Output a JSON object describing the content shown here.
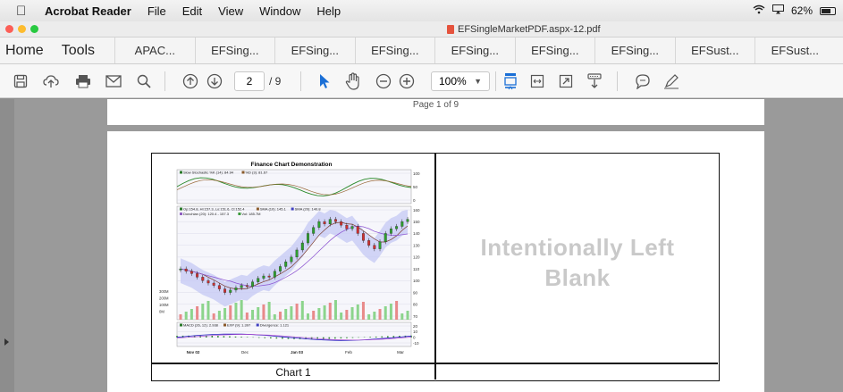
{
  "menubar": {
    "app_name": "Acrobat Reader",
    "items": [
      "File",
      "Edit",
      "View",
      "Window",
      "Help"
    ],
    "battery": "62%"
  },
  "window": {
    "document_title": "EFSingleMarketPDF.aspx-12.pdf"
  },
  "tabs": {
    "home": "Home",
    "tools": "Tools",
    "documents": [
      "APAC...",
      "EFSing...",
      "EFSing...",
      "EFSing...",
      "EFSing...",
      "EFSing...",
      "EFSing...",
      "EFSust...",
      "EFSust..."
    ]
  },
  "toolbar": {
    "current_page": "2",
    "page_count": "/ 9",
    "zoom": "100%",
    "icons": [
      "save-icon",
      "upload-icon",
      "print-icon",
      "email-icon",
      "search-icon",
      "page-up-icon",
      "page-down-icon",
      "select-arrow-icon",
      "hand-icon",
      "zoom-out-icon",
      "zoom-in-icon",
      "fit-page-icon",
      "fit-width-icon",
      "full-screen-icon",
      "read-mode-icon",
      "comment-icon",
      "sign-icon"
    ]
  },
  "page": {
    "page_label": "Page 1 of 9",
    "chart_caption": "Chart 1",
    "blank_line1": "Intentionally Left",
    "blank_line2": "Blank"
  },
  "chart_data": {
    "type": "line",
    "title": "Finance Chart Demonstration",
    "panels": [
      {
        "name": "stochastic",
        "legend": [
          "Slow Stochastic %K (14): 84.94",
          "%D (3): 81.67"
        ],
        "ylim": [
          0,
          100
        ],
        "ticks": [
          "100",
          "50",
          "0"
        ]
      },
      {
        "name": "price",
        "legend": [
          "Op:154.8, Hi:157.3, Lo:151.6, Cl:152.4",
          "SMA (10): 145.1",
          "SMA (20): 140.8",
          "Donchian (20): 120.4 - 157.3",
          "Vol: 185.7M"
        ],
        "ylim": [
          70,
          160
        ],
        "ticks": [
          "160",
          "150",
          "140",
          "130",
          "120",
          "110",
          "100",
          "90",
          "80",
          "70"
        ],
        "volume_ticks": [
          "300M",
          "200M",
          "100M",
          "0M"
        ],
        "close": [
          110,
          108,
          106,
          103,
          100,
          98,
          96,
          93,
          90,
          92,
          94,
          96,
          95,
          99,
          102,
          104,
          103,
          108,
          112,
          116,
          120,
          126,
          132,
          140,
          145,
          150,
          148,
          152,
          150,
          147,
          144,
          146,
          140,
          134,
          130,
          127,
          133,
          140,
          144,
          146,
          150,
          152
        ]
      },
      {
        "name": "macd",
        "legend": [
          "MACD (26, 12): 2.938",
          "EXP (9): 1.397",
          "Divergence: 1.121"
        ],
        "ylim": [
          -10,
          20
        ],
        "ticks": [
          "20",
          "10",
          "0",
          "-10"
        ]
      }
    ],
    "x_labels": [
      "Nov 02",
      "Dec",
      "Jan 03",
      "Feb",
      "Mar"
    ]
  }
}
